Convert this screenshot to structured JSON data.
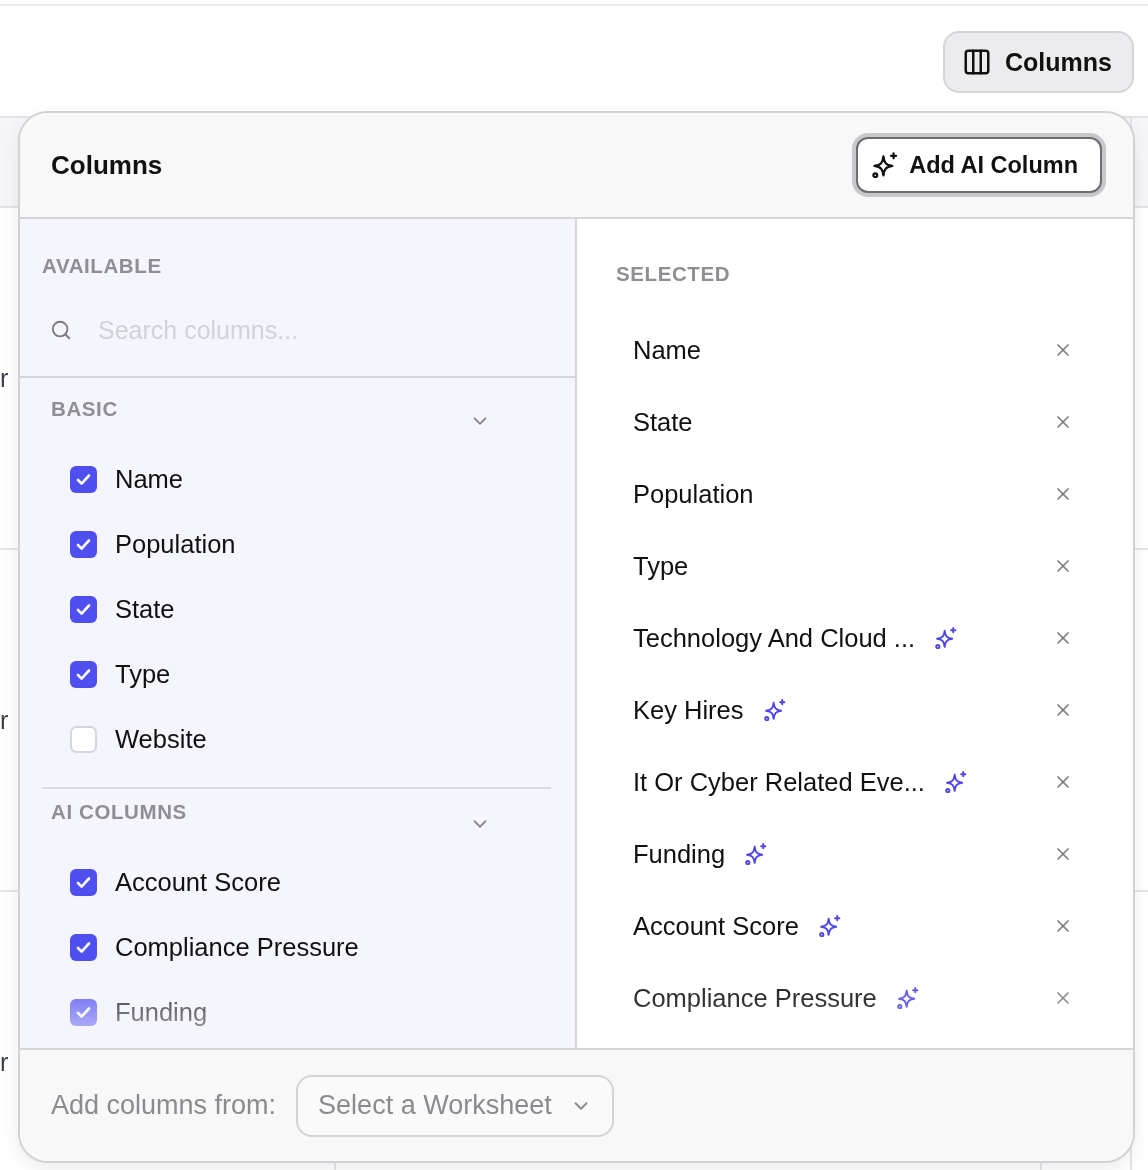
{
  "toolbar": {
    "columns_button": {
      "label": "Columns"
    }
  },
  "background_table": {
    "rows": [
      {
        "left_cell": "r"
      },
      {
        "left_cell": "r"
      },
      {
        "left_cell": "r"
      }
    ]
  },
  "popover": {
    "title": "Columns",
    "add_button": {
      "label": "Add AI Column",
      "focused": true
    },
    "available": {
      "label": "AVAILABLE",
      "search": {
        "placeholder": "Search columns..."
      },
      "groups": [
        {
          "label": "BASIC",
          "expanded": true,
          "items": [
            {
              "label": "Name",
              "checked": true
            },
            {
              "label": "Population",
              "checked": true
            },
            {
              "label": "State",
              "checked": true
            },
            {
              "label": "Type",
              "checked": true
            },
            {
              "label": "Website",
              "checked": false
            }
          ]
        },
        {
          "label": "AI COLUMNS",
          "expanded": true,
          "items": [
            {
              "label": "Account Score",
              "checked": true
            },
            {
              "label": "Compliance Pressure",
              "checked": true
            },
            {
              "label": "Funding",
              "checked": true
            }
          ]
        }
      ]
    },
    "selected": {
      "label": "SELECTED",
      "items": [
        {
          "label": "Name",
          "kind": "basic"
        },
        {
          "label": "State",
          "kind": "basic"
        },
        {
          "label": "Population",
          "kind": "basic"
        },
        {
          "label": "Type",
          "kind": "basic"
        },
        {
          "label": "Technology And Cloud ...",
          "kind": "ai"
        },
        {
          "label": "Key Hires",
          "kind": "ai"
        },
        {
          "label": "It Or Cyber Related Eve...",
          "kind": "ai"
        },
        {
          "label": "Funding",
          "kind": "ai"
        },
        {
          "label": "Account Score",
          "kind": "ai"
        },
        {
          "label": "Compliance Pressure",
          "kind": "ai"
        }
      ]
    },
    "footer": {
      "label": "Add columns from:",
      "select": {
        "placeholder": "Select a Worksheet"
      }
    }
  }
}
